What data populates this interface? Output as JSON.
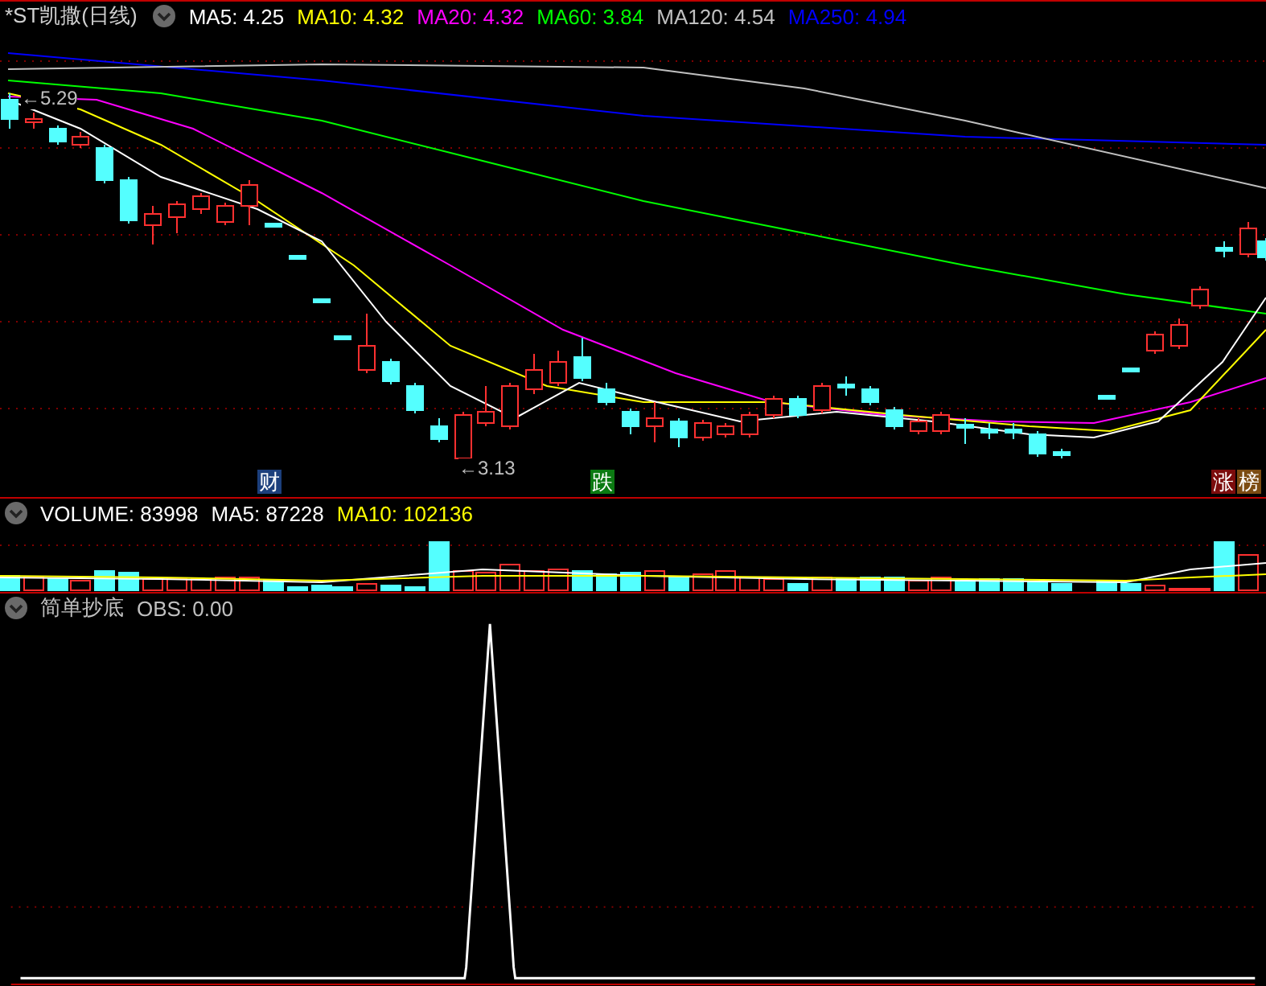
{
  "title": "*ST凯撒(日线)",
  "price_indicators": [
    {
      "label": "MA5: 4.25",
      "color": "#ffffff"
    },
    {
      "label": "MA10: 4.32",
      "color": "#ffff00"
    },
    {
      "label": "MA20: 4.32",
      "color": "#ff00ff"
    },
    {
      "label": "MA60: 3.84",
      "color": "#00ff00"
    },
    {
      "label": "MA120: 4.54",
      "color": "#c0c0c0"
    },
    {
      "label": "MA250: 4.94",
      "color": "#0000ff"
    }
  ],
  "price_labels": [
    {
      "text": "←5.29",
      "kind": "high"
    },
    {
      "text": "←3.13",
      "kind": "low"
    }
  ],
  "event_tags": [
    {
      "text": "财",
      "color": "#1c3f7c"
    },
    {
      "text": "跌",
      "color": "#0b7a12"
    },
    {
      "text": "涨",
      "color": "#7c0c0c"
    },
    {
      "text": "榜",
      "color": "#7c4c12"
    }
  ],
  "volume_panel": {
    "indicators": [
      {
        "label": "VOLUME: 83998",
        "color": "#ffffff"
      },
      {
        "label": "MA5: 87228",
        "color": "#ffffff"
      },
      {
        "label": "MA10: 102136",
        "color": "#ffff00"
      }
    ]
  },
  "signal_panel": {
    "indicators": [
      {
        "label": "简单抄底",
        "color": "#c0c0c0"
      },
      {
        "label": "OBS: 0.00",
        "color": "#c0c0c0"
      }
    ]
  }
}
